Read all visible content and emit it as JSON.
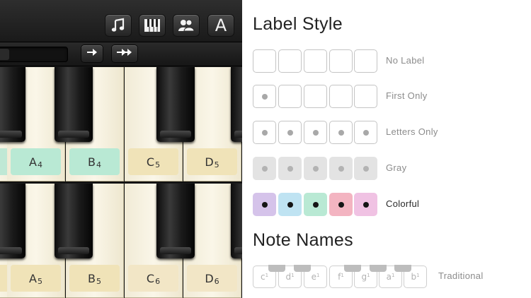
{
  "toolbar": {
    "buttons": [
      {
        "name": "music-note-icon",
        "glyph": ""
      },
      {
        "name": "piano-keys-icon",
        "glyph": ""
      },
      {
        "name": "two-users-icon",
        "glyph": ""
      },
      {
        "name": "label-toggle-button",
        "glyph": "A"
      }
    ]
  },
  "scroll_arrows": {
    "single": "→",
    "double": "⇉"
  },
  "keyboard_top": {
    "labels": [
      {
        "note": "",
        "octave": "",
        "color": "#bfe8d5"
      },
      {
        "note": "A",
        "octave": "4",
        "color": "#b9e9d4"
      },
      {
        "note": "B",
        "octave": "4",
        "color": "#b9e9d4"
      },
      {
        "note": "C",
        "octave": "5",
        "color": "#f0e3b8"
      },
      {
        "note": "D",
        "octave": "5",
        "color": "#f0e3b8"
      }
    ]
  },
  "keyboard_bottom": {
    "labels": [
      {
        "note": "",
        "octave": "",
        "color": "#f0e3b8"
      },
      {
        "note": "A",
        "octave": "5",
        "color": "#f0e3b8"
      },
      {
        "note": "B",
        "octave": "5",
        "color": "#f0e3b8"
      },
      {
        "note": "C",
        "octave": "6",
        "color": "#f2e6c6"
      },
      {
        "note": "D",
        "octave": "6",
        "color": "#f2e6c6"
      }
    ]
  },
  "settings": {
    "label_style_title": "Label Style",
    "styles": [
      {
        "label": "No Label",
        "selected": false
      },
      {
        "label": "First Only",
        "selected": false
      },
      {
        "label": "Letters Only",
        "selected": false
      },
      {
        "label": "Gray",
        "selected": false
      },
      {
        "label": "Colorful",
        "selected": true
      }
    ],
    "colorful_colors": [
      "#d5c3ea",
      "#bfe3f2",
      "#b9e9d4",
      "#f3b4c1",
      "#f0c2e3"
    ],
    "note_names_title": "Note Names",
    "traditional": {
      "label": "Traditional",
      "keys": [
        {
          "letter": "c",
          "sup": "1"
        },
        {
          "letter": "d",
          "sup": "1"
        },
        {
          "letter": "e",
          "sup": "1"
        },
        {
          "letter": "f",
          "sup": "1"
        },
        {
          "letter": "g",
          "sup": "1"
        },
        {
          "letter": "a",
          "sup": "1"
        },
        {
          "letter": "b",
          "sup": "1"
        }
      ]
    }
  }
}
